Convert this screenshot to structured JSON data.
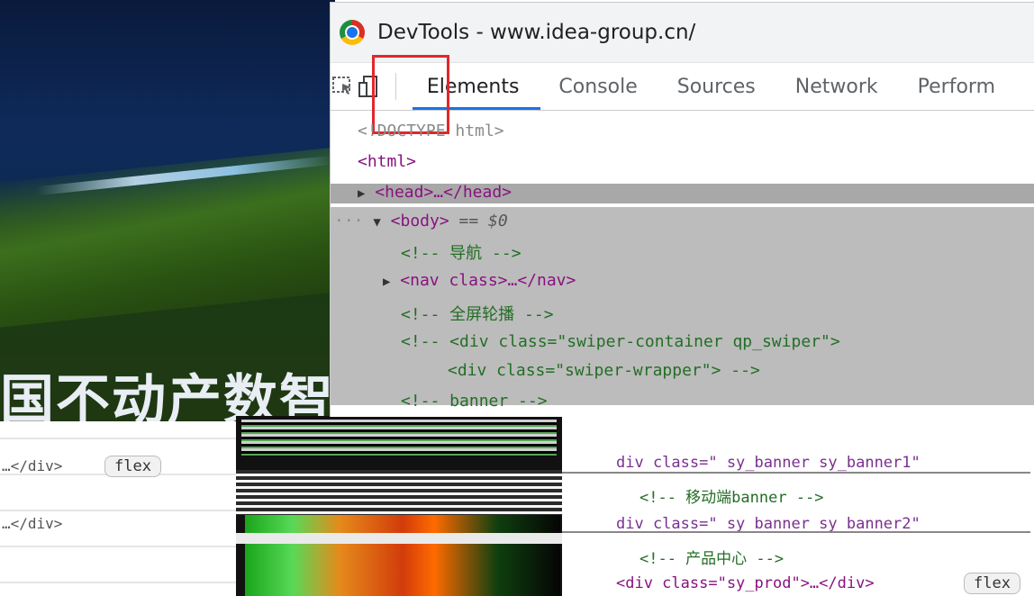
{
  "devtools": {
    "window_title": "DevTools - www.idea-group.cn/",
    "tabs": [
      {
        "label": "Elements",
        "active": true
      },
      {
        "label": "Console"
      },
      {
        "label": "Sources"
      },
      {
        "label": "Network"
      },
      {
        "label": "Perform"
      }
    ],
    "toolbar_icons": [
      "inspect-element-icon",
      "device-toolbar-icon"
    ],
    "accent_color": "#1a73e8",
    "highlight_color": "#e3262a"
  },
  "dom_tree": {
    "doctype": "<!DOCTYPE html>",
    "html_open": "<html>",
    "head": "<head>…</head>",
    "body_prefix": "···",
    "body_open": "<body>",
    "body_equals": "== $0",
    "comment_nav": "<!-- 导航 -->",
    "nav_node": "<nav class>…</nav>",
    "comment_carousel": "<!-- 全屏轮播 -->",
    "comment_swiper1": "<!-- <div class=\"swiper-container qp_swiper\">",
    "comment_swiper2": "<div class=\"swiper-wrapper\"> -->",
    "comment_banner": "<!-- banner -->",
    "div_banner1": "div class=\" sy_banner sy_banner1\"",
    "comment_mobile_banner": "<!-- 移动端banner -->",
    "div_banner2": "div class=\" sy_banner sy_banner2\"",
    "comment_products": "<!-- 产品中心 -->",
    "div_sy_prod": "<div class=\"sy_prod\">…</div>",
    "div_close_1": "…</div>",
    "div_close_2": "…</div>",
    "flex_badge": "flex",
    "flex_badge_2": "flex"
  },
  "site": {
    "hero_title": "国不动产数智"
  }
}
